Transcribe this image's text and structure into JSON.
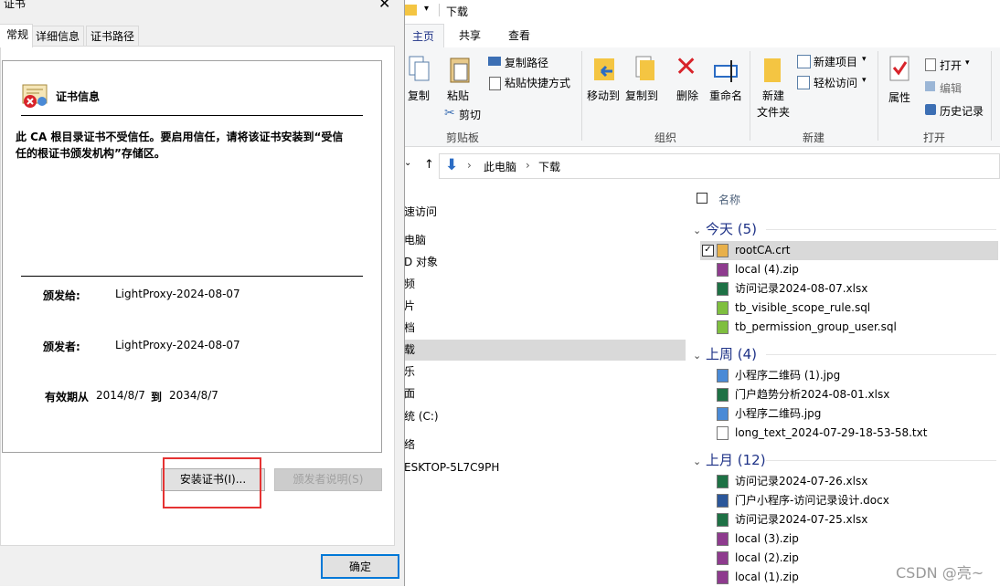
{
  "explorer": {
    "title": "下载",
    "ribbon_tabs": [
      "主页",
      "共享",
      "查看"
    ],
    "clipboard": {
      "copy": "复制",
      "paste": "粘贴",
      "copy_path": "复制路径",
      "paste_shortcut": "粘贴快捷方式",
      "cut": "剪切",
      "group": "剪贴板"
    },
    "organize": {
      "move_to": "移动到",
      "copy_to": "复制到",
      "delete": "删除",
      "rename": "重命名",
      "group": "组织"
    },
    "new": {
      "new_folder_l1": "新建",
      "new_folder_l2": "文件夹",
      "new_item": "新建项目",
      "easy_access": "轻松访问",
      "group": "新建"
    },
    "open": {
      "properties": "属性",
      "open": "打开",
      "edit": "编辑",
      "history": "历史记录",
      "group": "打开"
    },
    "breadcrumb": [
      "此电脑",
      "下载"
    ],
    "nav_items": [
      "速访问",
      "电脑",
      "D 对象",
      "频",
      "片",
      "档",
      "载",
      "乐",
      "面",
      "统 (C:)",
      "络",
      "ESKTOP-5L7C9PH"
    ],
    "column_name": "名称",
    "groups": [
      {
        "label": "今天 (5)",
        "files": [
          {
            "name": "rootCA.crt",
            "icon": "certificate-file-icon"
          },
          {
            "name": "local (4).zip",
            "icon": "zip-file-icon"
          },
          {
            "name": "访问记录2024-08-07.xlsx",
            "icon": "spreadsheet-file-icon"
          },
          {
            "name": "tb_visible_scope_rule.sql",
            "icon": "sql-file-icon"
          },
          {
            "name": "tb_permission_group_user.sql",
            "icon": "sql-file-icon"
          }
        ]
      },
      {
        "label": "上周 (4)",
        "files": [
          {
            "name": "小程序二维码 (1).jpg",
            "icon": "image-file-icon"
          },
          {
            "name": "门户趋势分析2024-08-01.xlsx",
            "icon": "spreadsheet-file-icon"
          },
          {
            "name": "小程序二维码.jpg",
            "icon": "image-file-icon"
          },
          {
            "name": "long_text_2024-07-29-18-53-58.txt",
            "icon": "text-file-icon"
          }
        ]
      },
      {
        "label": "上月 (12)",
        "files": [
          {
            "name": "访问记录2024-07-26.xlsx",
            "icon": "spreadsheet-file-icon"
          },
          {
            "name": "门户小程序-访问记录设计.docx",
            "icon": "word-file-icon"
          },
          {
            "name": "访问记录2024-07-25.xlsx",
            "icon": "spreadsheet-file-icon"
          },
          {
            "name": "local (3).zip",
            "icon": "zip-file-icon"
          },
          {
            "name": "local (2).zip",
            "icon": "zip-file-icon"
          },
          {
            "name": "local (1).zip",
            "icon": "zip-file-icon"
          }
        ]
      }
    ],
    "watermark": "CSDN @亮~"
  },
  "dialog": {
    "title": "证书",
    "tabs": [
      "常规",
      "详细信息",
      "证书路径"
    ],
    "section_title": "证书信息",
    "warning": "此 CA 根目录证书不受信任。要启用信任，请将该证书安装到“受信任的根证书颁发机构”存储区。",
    "issued_to_label": "颁发给:",
    "issued_to_value": "LightProxy-2024-08-07",
    "issued_by_label": "颁发者:",
    "issued_by_value": "LightProxy-2024-08-07",
    "validity_label": "有效期从",
    "valid_from": "2014/8/7",
    "valid_to_label": "到",
    "valid_to": "2034/8/7",
    "install_button": "安装证书(I)...",
    "issuer_statement_button": "颁发者说明(S)",
    "ok_button": "确定",
    "colors": {
      "highlight": "#e53333",
      "accent": "#0078d7"
    }
  }
}
